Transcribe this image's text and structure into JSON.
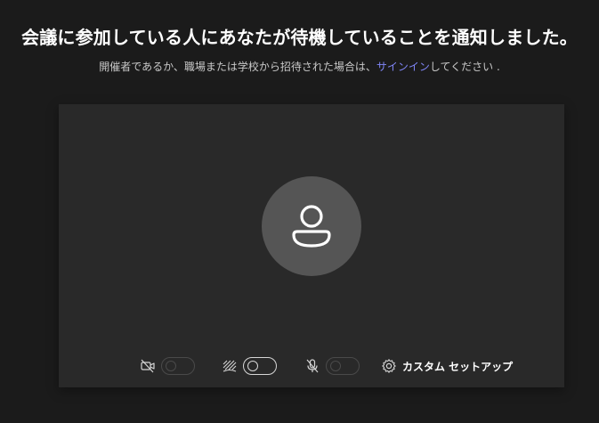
{
  "heading": "会議に参加している人にあなたが待機していることを通知しました。",
  "subtext": {
    "before": "開催者であるか、職場または学校から招待された場合は、",
    "link": "サインイン",
    "after": "してください ."
  },
  "controls": {
    "camera": {
      "icon": "camera-off-icon",
      "state": "off"
    },
    "background_effects": {
      "icon": "background-blur-icon",
      "state": "off-outline"
    },
    "microphone": {
      "icon": "mic-off-icon",
      "state": "off"
    },
    "custom_setup_label": "カスタム セットアップ"
  },
  "colors": {
    "background": "#1b1b1b",
    "panel": "#292929",
    "avatar": "#555555",
    "link": "#7f85f5"
  }
}
